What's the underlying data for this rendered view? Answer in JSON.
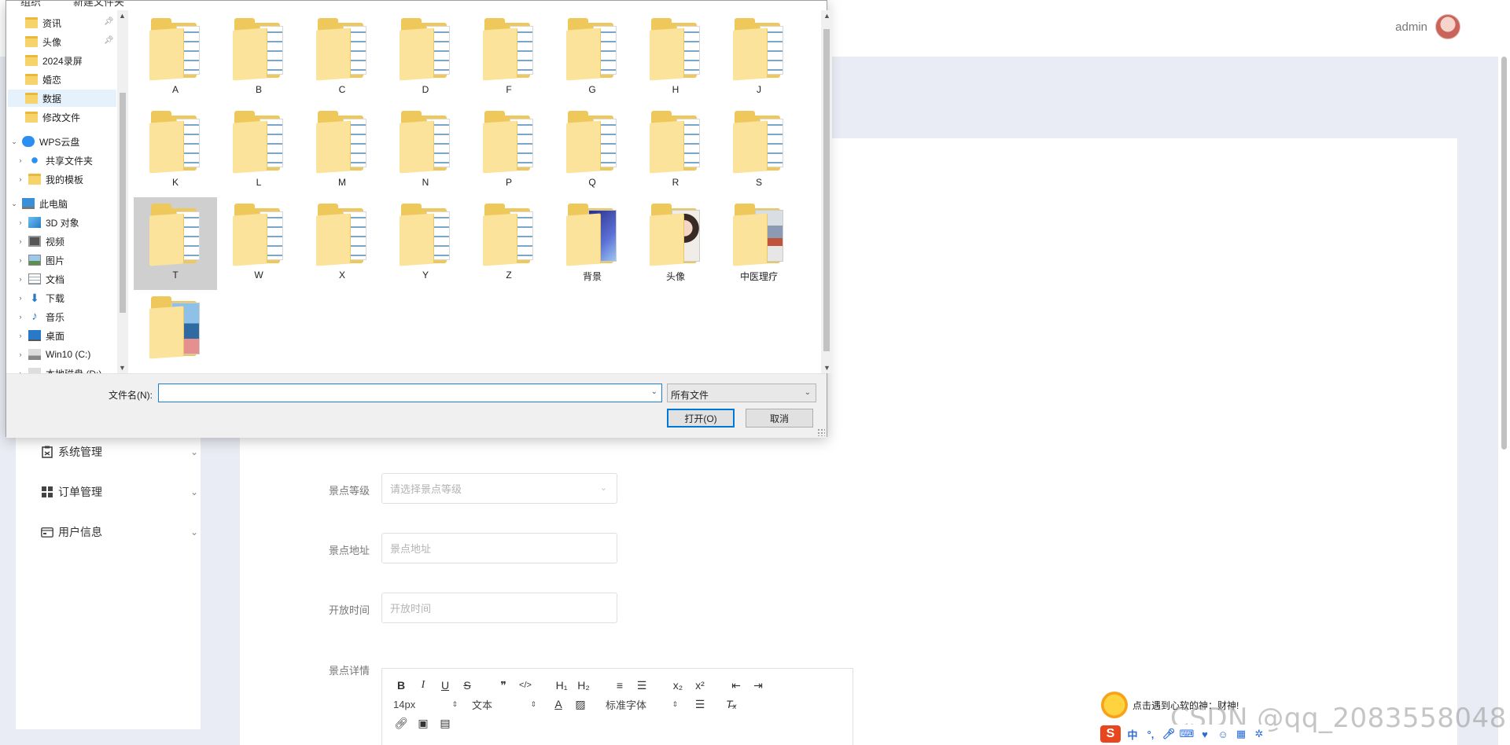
{
  "header": {
    "admin_name": "admin"
  },
  "sidebar_menu": [
    {
      "label": "系统管理",
      "icon": "clipboard-icon"
    },
    {
      "label": "订单管理",
      "icon": "grid-icon"
    },
    {
      "label": "用户信息",
      "icon": "id-card-icon"
    }
  ],
  "form": {
    "level": {
      "label": "景点等级",
      "placeholder": "请选择景点等级"
    },
    "address": {
      "label": "景点地址",
      "placeholder": "景点地址"
    },
    "open_time": {
      "label": "开放时间",
      "placeholder": "开放时间"
    },
    "detail": {
      "label": "景点详情"
    }
  },
  "editor_toolbar": {
    "row1": [
      "B",
      "I",
      "U",
      "S",
      "❞",
      "</>",
      "H₁",
      "H₂",
      "≡",
      "☰",
      "x₂",
      "x²",
      "⇤",
      "⇥"
    ],
    "font_size": "14px",
    "text_style": "文本",
    "font_family": "标准字体"
  },
  "dialog": {
    "toolbar": {
      "organize": "组织",
      "new_folder": "新建文件夹"
    },
    "tree": [
      {
        "label": "资讯",
        "type": "folder",
        "pinned": true
      },
      {
        "label": "头像",
        "type": "folder",
        "pinned": true
      },
      {
        "label": "2024录屏",
        "type": "folder"
      },
      {
        "label": "婚恋",
        "type": "folder"
      },
      {
        "label": "数据",
        "type": "folder",
        "selected": true
      },
      {
        "label": "修改文件",
        "type": "folder"
      },
      {
        "label": "WPS云盘",
        "type": "cloud",
        "expanded": true
      },
      {
        "label": "共享文件夹",
        "type": "share"
      },
      {
        "label": "我的模板",
        "type": "folder"
      },
      {
        "label": "此电脑",
        "type": "pc",
        "expanded": true
      },
      {
        "label": "3D 对象",
        "type": "3d"
      },
      {
        "label": "视频",
        "type": "video"
      },
      {
        "label": "图片",
        "type": "picture"
      },
      {
        "label": "文档",
        "type": "document"
      },
      {
        "label": "下载",
        "type": "download"
      },
      {
        "label": "音乐",
        "type": "music"
      },
      {
        "label": "桌面",
        "type": "desktop"
      },
      {
        "label": "Win10 (C:)",
        "type": "drive"
      },
      {
        "label": "本地磁盘 (D:)",
        "type": "drive"
      }
    ],
    "files": [
      {
        "name": "A"
      },
      {
        "name": "B"
      },
      {
        "name": "C"
      },
      {
        "name": "D"
      },
      {
        "name": "F"
      },
      {
        "name": "G"
      },
      {
        "name": "H"
      },
      {
        "name": "J"
      },
      {
        "name": "K"
      },
      {
        "name": "L"
      },
      {
        "name": "M"
      },
      {
        "name": "N"
      },
      {
        "name": "P"
      },
      {
        "name": "Q"
      },
      {
        "name": "R"
      },
      {
        "name": "S"
      },
      {
        "name": "T",
        "selected": true
      },
      {
        "name": "W"
      },
      {
        "name": "X"
      },
      {
        "name": "Y"
      },
      {
        "name": "Z"
      },
      {
        "name": "背景",
        "kind": "image-blue"
      },
      {
        "name": "头像",
        "kind": "image-portrait"
      },
      {
        "name": "中医理疗",
        "kind": "image-mixed"
      },
      {
        "name": "",
        "kind": "image-scenery"
      }
    ],
    "file_name_label": "文件名(N):",
    "file_name_value": "",
    "file_type": "所有文件",
    "open_button": "打开(O)",
    "cancel_button": "取消"
  },
  "ime": {
    "tip": "点击遇到心软的神：财神!",
    "logo": "S",
    "mode": "中"
  },
  "watermark": "CSDN @qq_2083558048",
  "colors": {
    "accent": "#0078d7",
    "page_bg": "#e9ecf4",
    "folder": "#efc85b"
  }
}
